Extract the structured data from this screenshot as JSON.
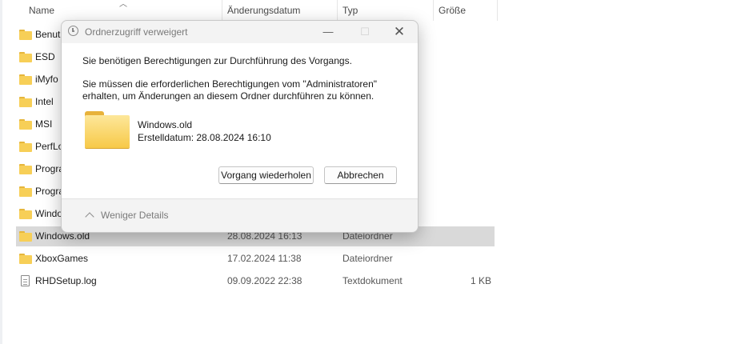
{
  "columns": {
    "name": "Name",
    "date": "Änderungsdatum",
    "type": "Typ",
    "size": "Größe"
  },
  "files": [
    {
      "name": "Benut",
      "date": "",
      "type": "",
      "size": "",
      "icon": "folder-icon"
    },
    {
      "name": "ESD",
      "date": "",
      "type": "",
      "size": "",
      "icon": "folder-icon"
    },
    {
      "name": "iMyfo",
      "date": "",
      "type": "",
      "size": "",
      "icon": "folder-icon"
    },
    {
      "name": "Intel",
      "date": "",
      "type": "",
      "size": "",
      "icon": "folder-icon"
    },
    {
      "name": "MSI",
      "date": "",
      "type": "",
      "size": "",
      "icon": "folder-icon"
    },
    {
      "name": "PerfLo",
      "date": "",
      "type": "",
      "size": "",
      "icon": "folder-icon"
    },
    {
      "name": "Progra",
      "date": "",
      "type": "",
      "size": "",
      "icon": "folder-icon"
    },
    {
      "name": "Progra",
      "date": "",
      "type": "",
      "size": "",
      "icon": "folder-icon"
    },
    {
      "name": "Windo",
      "date": "",
      "type": "",
      "size": "",
      "icon": "folder-icon"
    },
    {
      "name": "Windows.old",
      "date": "28.08.2024 16:13",
      "type": "Dateiordner",
      "size": "",
      "icon": "folder-icon"
    },
    {
      "name": "XboxGames",
      "date": "17.02.2024 11:38",
      "type": "Dateiordner",
      "size": "",
      "icon": "folder-icon"
    },
    {
      "name": "RHDSetup.log",
      "date": "09.09.2022 22:38",
      "type": "Textdokument",
      "size": "1 KB",
      "icon": "text-file-icon"
    }
  ],
  "dialog": {
    "title": "Ordnerzugriff verweigert",
    "title_icon": "clock-icon",
    "minimize_glyph": "—",
    "maximize_glyph": "☐",
    "close_glyph": "✕",
    "message": "Sie benötigen Berechtigungen zur Durchführung des Vorgangs.",
    "detail": "Sie müssen die erforderlichen Berechtigungen vom \"Administratoren\" erhalten, um Änderungen an diesem Ordner durchführen zu können.",
    "folder_name": "Windows.old",
    "folder_created": "Erstelldatum: 28.08.2024 16:10",
    "retry_label": "Vorgang wiederholen",
    "cancel_label": "Abbrechen",
    "details_toggle": "Weniger Details"
  },
  "colors": {
    "selected_row": "#d9d9d9",
    "folder_yellow": "#f7cf57"
  }
}
